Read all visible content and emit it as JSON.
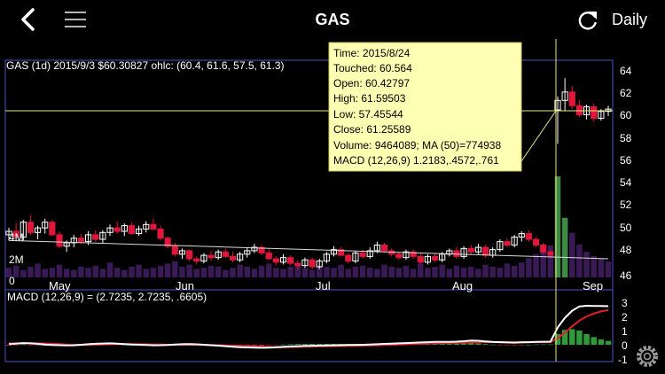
{
  "header": {
    "title": "GAS",
    "interval_label": "Daily",
    "icons": {
      "back": "back-chevron-icon",
      "menu": "hamburger-menu-icon",
      "refresh": "refresh-icon"
    }
  },
  "main_chart": {
    "info_line": "GAS (1d) 2015/9/3 $60.30827 ohlc: (60.4, 61.6, 57.5, 61.3)",
    "price_ticks": [
      "64",
      "62",
      "60",
      "58",
      "56",
      "54",
      "52",
      "50",
      "48",
      "46"
    ],
    "volume_ticks": [
      "4M",
      "2M",
      "0"
    ],
    "month_labels": [
      "May",
      "Jun",
      "Jul",
      "Aug",
      "Sep"
    ]
  },
  "tooltip": {
    "time": "Time: 2015/8/24",
    "touched": "Touched: 60.564",
    "open": "Open: 60.42797",
    "high": "High: 61.59503",
    "low": "Low: 57.45544",
    "close": "Close: 61.25589",
    "volume": "Volume: 9464089; MA (50)=774938",
    "macd": "MACD (12,26,9) 1.2183,.4572,.761"
  },
  "macd_panel": {
    "label": "MACD (12,26,9) = (2.7235, 2.7235, .6605)",
    "ticks": [
      "3",
      "2",
      "1",
      "0",
      "-1"
    ],
    "settings_icon": "gear-icon"
  },
  "colors": {
    "background": "#000000",
    "up": "#ffffff",
    "down": "#e0173b",
    "volume": "#3a1a55",
    "volume_spike": "#3e8a45",
    "macd_hist": "#2f9a3a",
    "macd_signal": "#e01f2a",
    "macd_line": "#ffffff",
    "tooltip_bg": "#ffffb4",
    "tooltip_border": "#c9c060",
    "crosshair": "#e6e68a",
    "panel_border": "#4d52c8"
  },
  "chart_data": {
    "type": "candlestick",
    "symbol": "GAS",
    "interval": "1d",
    "ylim": [
      45.5,
      65
    ],
    "candles": [
      [
        49.5,
        50.1,
        49.0,
        49.8
      ],
      [
        49.8,
        50.5,
        49.2,
        49.3
      ],
      [
        49.3,
        50.8,
        49.0,
        50.6
      ],
      [
        50.6,
        51.2,
        49.5,
        49.7
      ],
      [
        49.7,
        50.3,
        49.1,
        50.1
      ],
      [
        50.1,
        50.9,
        49.6,
        50.6
      ],
      [
        50.6,
        50.8,
        49.4,
        49.5
      ],
      [
        49.5,
        49.8,
        48.3,
        48.5
      ],
      [
        48.5,
        49.0,
        48.0,
        48.8
      ],
      [
        48.8,
        49.5,
        48.4,
        49.2
      ],
      [
        49.2,
        49.6,
        48.7,
        48.9
      ],
      [
        48.9,
        49.8,
        48.6,
        49.5
      ],
      [
        49.5,
        49.9,
        48.9,
        49.1
      ],
      [
        49.1,
        49.9,
        48.8,
        49.7
      ],
      [
        49.7,
        50.4,
        49.4,
        50.1
      ],
      [
        50.1,
        50.7,
        49.6,
        49.8
      ],
      [
        49.8,
        50.5,
        49.4,
        50.3
      ],
      [
        50.3,
        50.6,
        49.5,
        49.6
      ],
      [
        49.6,
        50.3,
        49.4,
        50.0
      ],
      [
        50.0,
        50.7,
        49.7,
        50.4
      ],
      [
        50.4,
        50.9,
        49.9,
        50.0
      ],
      [
        50.0,
        50.3,
        49.0,
        49.2
      ],
      [
        49.2,
        49.4,
        48.3,
        48.5
      ],
      [
        48.5,
        48.8,
        47.6,
        47.8
      ],
      [
        47.8,
        48.3,
        47.4,
        48.1
      ],
      [
        48.1,
        48.2,
        47.2,
        47.4
      ],
      [
        47.4,
        47.6,
        46.9,
        47.2
      ],
      [
        47.2,
        47.9,
        47.0,
        47.7
      ],
      [
        47.7,
        48.1,
        47.2,
        47.5
      ],
      [
        47.5,
        48.2,
        47.3,
        48.0
      ],
      [
        48.0,
        48.3,
        47.5,
        47.6
      ],
      [
        47.6,
        48.0,
        47.1,
        47.3
      ],
      [
        47.3,
        48.0,
        47.1,
        47.8
      ],
      [
        47.8,
        48.4,
        47.5,
        48.1
      ],
      [
        48.1,
        48.7,
        47.9,
        48.4
      ],
      [
        48.4,
        48.6,
        47.7,
        47.9
      ],
      [
        47.9,
        48.3,
        47.3,
        47.4
      ],
      [
        47.4,
        47.6,
        46.8,
        47.1
      ],
      [
        47.1,
        47.8,
        46.9,
        47.5
      ],
      [
        47.5,
        47.7,
        46.8,
        47.0
      ],
      [
        47.0,
        47.3,
        46.5,
        46.8
      ],
      [
        46.8,
        47.5,
        46.6,
        47.3
      ],
      [
        47.3,
        47.5,
        46.5,
        46.7
      ],
      [
        46.7,
        47.4,
        46.5,
        47.2
      ],
      [
        47.2,
        48.0,
        47.0,
        47.8
      ],
      [
        47.8,
        48.5,
        47.6,
        48.2
      ],
      [
        48.2,
        48.4,
        47.6,
        47.7
      ],
      [
        47.7,
        47.9,
        47.0,
        47.2
      ],
      [
        47.2,
        48.1,
        47.0,
        47.9
      ],
      [
        47.9,
        48.2,
        47.4,
        47.6
      ],
      [
        47.6,
        48.4,
        47.4,
        48.1
      ],
      [
        48.1,
        48.9,
        47.9,
        48.6
      ],
      [
        48.6,
        48.8,
        47.9,
        48.1
      ],
      [
        48.1,
        48.3,
        47.6,
        47.8
      ],
      [
        47.8,
        48.0,
        47.3,
        47.5
      ],
      [
        47.5,
        48.2,
        47.3,
        48.0
      ],
      [
        48.0,
        48.2,
        47.4,
        47.6
      ],
      [
        47.6,
        47.9,
        46.9,
        47.1
      ],
      [
        47.1,
        47.8,
        46.9,
        47.6
      ],
      [
        47.6,
        47.9,
        47.1,
        47.3
      ],
      [
        47.3,
        48.0,
        47.1,
        47.8
      ],
      [
        47.8,
        48.3,
        47.6,
        48.1
      ],
      [
        48.1,
        48.4,
        47.4,
        47.6
      ],
      [
        47.6,
        48.5,
        47.4,
        48.3
      ],
      [
        48.3,
        48.6,
        47.8,
        48.0
      ],
      [
        48.0,
        48.7,
        47.8,
        48.4
      ],
      [
        48.4,
        48.6,
        47.5,
        47.7
      ],
      [
        47.7,
        48.4,
        47.5,
        48.2
      ],
      [
        48.2,
        49.1,
        48.0,
        48.9
      ],
      [
        48.9,
        49.2,
        48.4,
        48.6
      ],
      [
        48.6,
        49.5,
        48.4,
        49.3
      ],
      [
        49.3,
        49.8,
        48.9,
        49.6
      ],
      [
        49.6,
        49.9,
        48.9,
        49.1
      ],
      [
        49.1,
        49.3,
        48.4,
        48.6
      ],
      [
        48.6,
        48.8,
        47.8,
        48.0
      ],
      [
        48.0,
        48.2,
        47.5,
        47.7
      ],
      [
        60.43,
        61.6,
        57.46,
        61.26
      ],
      [
        61.26,
        63.2,
        60.3,
        62.0
      ],
      [
        62.0,
        62.5,
        60.5,
        60.8
      ],
      [
        60.8,
        61.3,
        59.8,
        60.0
      ],
      [
        60.0,
        60.9,
        59.6,
        60.7
      ],
      [
        60.7,
        61.0,
        59.4,
        59.7
      ],
      [
        59.7,
        60.5,
        59.5,
        60.3
      ],
      [
        60.3,
        60.8,
        59.9,
        60.5
      ]
    ],
    "volume_bars": [
      0.9,
      1.1,
      0.7,
      1.0,
      1.3,
      0.8,
      0.9,
      1.2,
      0.8,
      0.7,
      1.0,
      0.9,
      1.1,
      0.8,
      1.4,
      0.9,
      0.7,
      1.0,
      1.2,
      0.8,
      0.9,
      1.1,
      1.3,
      1.5,
      1.0,
      1.2,
      0.8,
      0.9,
      1.1,
      1.0,
      0.7,
      0.9,
      1.2,
      1.0,
      0.8,
      1.1,
      1.3,
      0.9,
      0.8,
      1.0,
      1.2,
      0.9,
      0.7,
      1.1,
      1.0,
      0.9,
      1.2,
      0.8,
      1.0,
      1.1,
      0.9,
      0.8,
      1.2,
      1.0,
      0.9,
      1.1,
      0.8,
      1.3,
      0.9,
      1.0,
      1.2,
      0.8,
      1.1,
      0.9,
      1.0,
      0.8,
      1.2,
      1.0,
      0.9,
      1.3,
      1.1,
      1.4,
      1.8,
      2.2,
      2.6,
      3.0,
      9.5,
      5.6,
      4.2,
      3.1,
      2.4,
      2.0,
      1.8,
      1.5
    ],
    "volume_ylim": [
      0,
      10
    ],
    "moving_average_start": 49.0,
    "moving_average_end": 47.4,
    "macd_line": [
      0.05,
      0.08,
      0.12,
      0.1,
      0.06,
      0.02,
      -0.01,
      -0.03,
      -0.05,
      -0.04,
      0.0,
      0.04,
      0.07,
      0.09,
      0.1,
      0.08,
      0.05,
      0.02,
      0.0,
      -0.02,
      -0.04,
      -0.03,
      -0.01,
      0.02,
      0.04,
      0.05,
      0.03,
      0.0,
      -0.03,
      -0.06,
      -0.1,
      -0.14,
      -0.17,
      -0.19,
      -0.2,
      -0.21,
      -0.2,
      -0.18,
      -0.15,
      -0.12,
      -0.1,
      -0.08,
      -0.07,
      -0.06,
      -0.05,
      -0.04,
      -0.03,
      -0.02,
      -0.01,
      0.0,
      0.02,
      0.04,
      0.06,
      0.08,
      0.1,
      0.12,
      0.14,
      0.16,
      0.18,
      0.2,
      0.2,
      0.2,
      0.22,
      0.25,
      0.3,
      0.28,
      0.24,
      0.2,
      0.18,
      0.16,
      0.15,
      0.17,
      0.18,
      0.2,
      0.21,
      0.22,
      1.22,
      1.9,
      2.4,
      2.7,
      2.75,
      2.74,
      2.73,
      2.72
    ],
    "macd_signal": [
      0.1,
      0.1,
      0.1,
      0.11,
      0.1,
      0.09,
      0.07,
      0.05,
      0.02,
      0.0,
      -0.01,
      -0.01,
      0.0,
      0.02,
      0.04,
      0.05,
      0.05,
      0.05,
      0.04,
      0.03,
      0.02,
      0.01,
      0.0,
      0.0,
      0.0,
      0.0,
      0.0,
      -0.01,
      -0.02,
      -0.03,
      -0.05,
      -0.07,
      -0.09,
      -0.11,
      -0.13,
      -0.15,
      -0.16,
      -0.17,
      -0.17,
      -0.16,
      -0.15,
      -0.14,
      -0.13,
      -0.12,
      -0.11,
      -0.1,
      -0.09,
      -0.08,
      -0.07,
      -0.06,
      -0.05,
      -0.04,
      -0.02,
      -0.01,
      0.01,
      0.03,
      0.05,
      0.07,
      0.09,
      0.11,
      0.12,
      0.13,
      0.14,
      0.15,
      0.17,
      0.18,
      0.19,
      0.19,
      0.19,
      0.18,
      0.18,
      0.18,
      0.18,
      0.18,
      0.18,
      0.19,
      0.46,
      0.85,
      1.3,
      1.7,
      2.0,
      2.2,
      2.35,
      2.45
    ],
    "macd_hist_ylim": [
      -1,
      3.6
    ]
  }
}
